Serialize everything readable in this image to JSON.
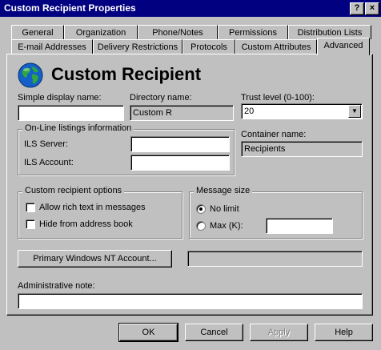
{
  "window": {
    "title": "Custom Recipient Properties",
    "help_glyph": "?",
    "close_glyph": "×"
  },
  "tabs_row1": [
    "General",
    "Organization",
    "Phone/Notes",
    "Permissions",
    "Distribution Lists"
  ],
  "tabs_row2": [
    "E-mail Addresses",
    "Delivery Restrictions",
    "Protocols",
    "Custom Attributes",
    "Advanced"
  ],
  "active_tab": "Advanced",
  "header": {
    "title": "Custom Recipient",
    "icon": "globe-icon"
  },
  "fields": {
    "simple_display_name": {
      "label": "Simple display name:",
      "value": ""
    },
    "directory_name": {
      "label": "Directory name:",
      "value": "Custom R"
    },
    "trust_level": {
      "label": "Trust level (0-100):",
      "value": "20"
    },
    "container_name": {
      "label": "Container name:",
      "value": "Recipients"
    }
  },
  "online_listings": {
    "legend": "On-Line listings information",
    "ils_server_label": "ILS Server:",
    "ils_server_value": "",
    "ils_account_label": "ILS Account:",
    "ils_account_value": ""
  },
  "recipient_options": {
    "legend": "Custom recipient options",
    "allow_rich_text": {
      "label": "Allow rich text in messages",
      "checked": false
    },
    "hide_from_address_book": {
      "label": "Hide from address book",
      "checked": false
    }
  },
  "message_size": {
    "legend": "Message size",
    "no_limit": {
      "label": "No limit",
      "selected": true
    },
    "max": {
      "label": "Max (K):",
      "selected": false,
      "value": ""
    }
  },
  "nt_account": {
    "button_label": "Primary Windows NT Account...",
    "value": ""
  },
  "admin_note": {
    "label": "Administrative note:",
    "value": ""
  },
  "buttons": {
    "ok": "OK",
    "cancel": "Cancel",
    "apply": "Apply",
    "help": "Help"
  }
}
